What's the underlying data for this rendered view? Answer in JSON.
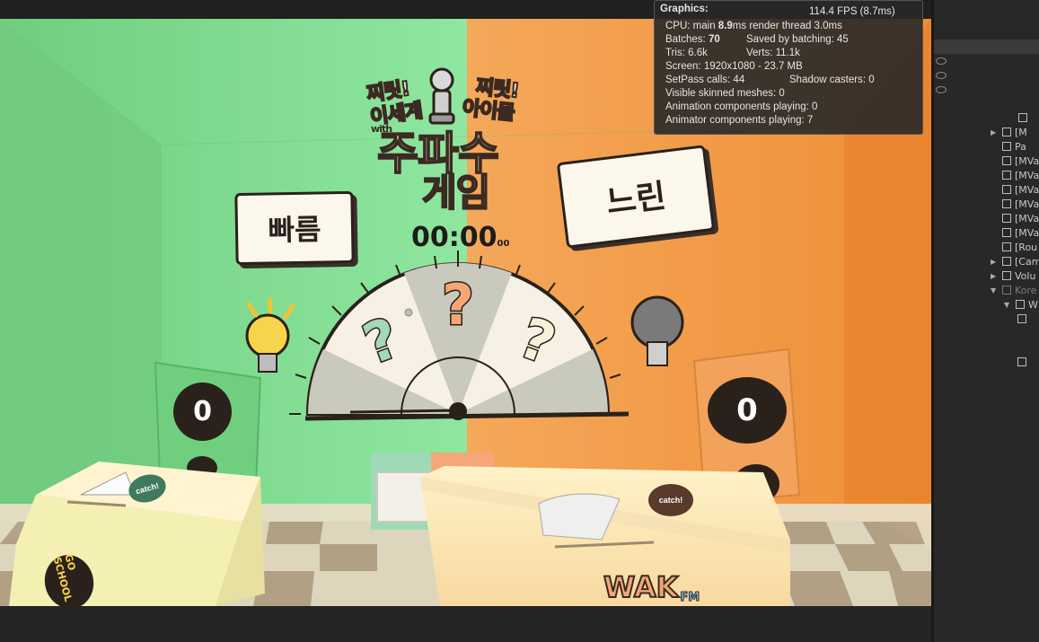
{
  "stats": {
    "title": "Graphics:",
    "fps": "114.4 FPS (8.7ms)",
    "cpu_prefix": "CPU: main ",
    "cpu_main": "8.9",
    "cpu_suffix": "ms  render thread 3.0ms",
    "batches_prefix": "Batches: ",
    "batches": "70",
    "saved_batching": "Saved by batching: 45",
    "tris": "Tris: 6.6k",
    "verts": "Verts: 11.1k",
    "screen": "Screen: 1920x1080 - 23.7 MB",
    "setpass": "SetPass calls: 44",
    "shadow_casters": "Shadow casters: 0",
    "skinned": "Visible skinned meshes: 0",
    "animation": "Animation components playing: 0",
    "animator": "Animator components playing: 7"
  },
  "game": {
    "sign_fast": "빠름",
    "sign_slow": "느린",
    "timer_main": "00:00",
    "timer_small": "00",
    "score_left": "0",
    "score_right": "0",
    "logo_top_left": "찌릿!",
    "logo_top_left2": "이세계",
    "logo_with": "with",
    "logo_top_right": "찌릿!",
    "logo_top_right2": "아이돌",
    "logo_main1": "주파수",
    "logo_main2": "게임",
    "question_mark": "?",
    "badge_left": "catch!",
    "badge_right": "catch!",
    "sticker_left": "GO SCHOOL",
    "sticker_right": "WAK",
    "sticker_right_suffix": "FM"
  },
  "hierarchy": {
    "items": [
      {
        "label": "[M"
      },
      {
        "label": "Pa"
      },
      {
        "label": "[MVa"
      },
      {
        "label": "[MVa"
      },
      {
        "label": "[MVa"
      },
      {
        "label": "[MVa"
      },
      {
        "label": "[MVa"
      },
      {
        "label": "[MVa"
      },
      {
        "label": "[Rou"
      },
      {
        "label": "[Cam"
      },
      {
        "label": "Volu"
      },
      {
        "label": "Kore"
      },
      {
        "label": "W"
      }
    ]
  },
  "colors": {
    "green_wall": "#8fe39d",
    "orange_wall": "#f0a24c",
    "panel_bg": "#282828"
  }
}
